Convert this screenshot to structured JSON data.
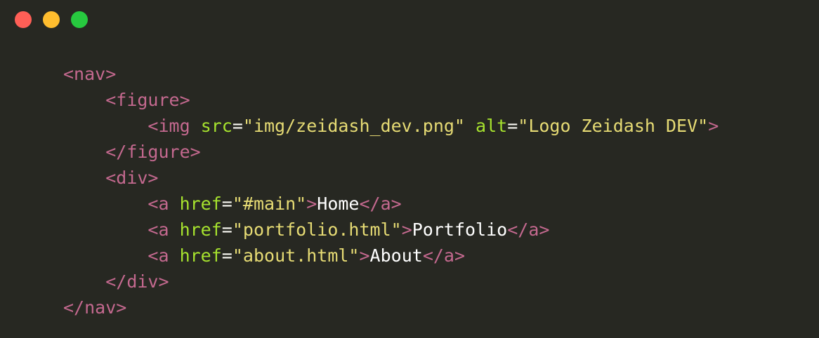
{
  "window": {
    "buttons": [
      {
        "name": "close",
        "color": "#ff5f56"
      },
      {
        "name": "minimize",
        "color": "#ffbd2e"
      },
      {
        "name": "maximize",
        "color": "#27c93f"
      }
    ]
  },
  "colors": {
    "background": "#272822",
    "tag": "#c4698f",
    "attribute": "#a6e22e",
    "string": "#e6db74",
    "text": "#ffffff"
  },
  "code": {
    "lines": [
      {
        "indent": "",
        "tokens": [
          {
            "t": "tag",
            "v": "<nav>"
          }
        ]
      },
      {
        "indent": "    ",
        "tokens": [
          {
            "t": "tag",
            "v": "<figure>"
          }
        ]
      },
      {
        "indent": "        ",
        "tokens": [
          {
            "t": "tag",
            "v": "<img "
          },
          {
            "t": "attr",
            "v": "src"
          },
          {
            "t": "eq",
            "v": "="
          },
          {
            "t": "str",
            "v": "\"img/zeidash_dev.png\""
          },
          {
            "t": "eq",
            "v": " "
          },
          {
            "t": "attr",
            "v": "alt"
          },
          {
            "t": "eq",
            "v": "="
          },
          {
            "t": "str",
            "v": "\"Logo Zeidash DEV\""
          },
          {
            "t": "tag",
            "v": ">"
          }
        ]
      },
      {
        "indent": "    ",
        "tokens": [
          {
            "t": "tag",
            "v": "</figure>"
          }
        ]
      },
      {
        "indent": "    ",
        "tokens": [
          {
            "t": "tag",
            "v": "<div>"
          }
        ]
      },
      {
        "indent": "        ",
        "tokens": [
          {
            "t": "tag",
            "v": "<a "
          },
          {
            "t": "attr",
            "v": "href"
          },
          {
            "t": "eq",
            "v": "="
          },
          {
            "t": "str",
            "v": "\"#main\""
          },
          {
            "t": "tag",
            "v": ">"
          },
          {
            "t": "text",
            "v": "Home"
          },
          {
            "t": "tag",
            "v": "</a>"
          }
        ]
      },
      {
        "indent": "        ",
        "tokens": [
          {
            "t": "tag",
            "v": "<a "
          },
          {
            "t": "attr",
            "v": "href"
          },
          {
            "t": "eq",
            "v": "="
          },
          {
            "t": "str",
            "v": "\"portfolio.html\""
          },
          {
            "t": "tag",
            "v": ">"
          },
          {
            "t": "text",
            "v": "Portfolio"
          },
          {
            "t": "tag",
            "v": "</a>"
          }
        ]
      },
      {
        "indent": "        ",
        "tokens": [
          {
            "t": "tag",
            "v": "<a "
          },
          {
            "t": "attr",
            "v": "href"
          },
          {
            "t": "eq",
            "v": "="
          },
          {
            "t": "str",
            "v": "\"about.html\""
          },
          {
            "t": "tag",
            "v": ">"
          },
          {
            "t": "text",
            "v": "About"
          },
          {
            "t": "tag",
            "v": "</a>"
          }
        ]
      },
      {
        "indent": "    ",
        "tokens": [
          {
            "t": "tag",
            "v": "</div>"
          }
        ]
      },
      {
        "indent": "",
        "tokens": [
          {
            "t": "tag",
            "v": "</nav>"
          }
        ]
      }
    ]
  }
}
